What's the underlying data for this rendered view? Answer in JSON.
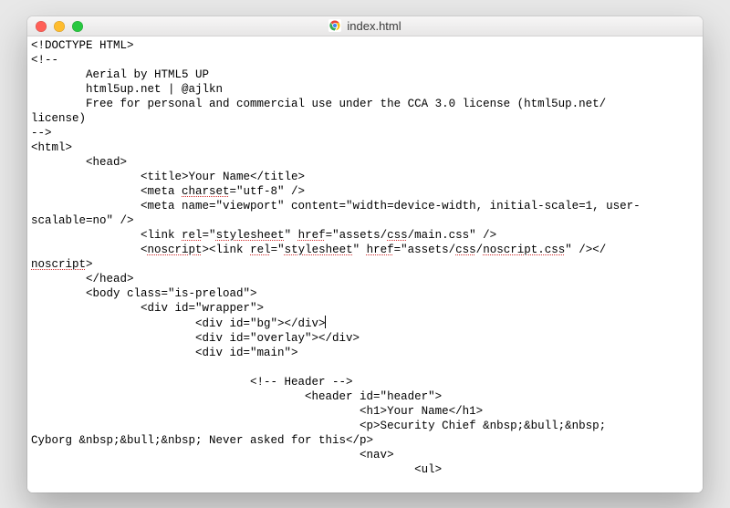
{
  "window": {
    "title": "index.html",
    "favicon_name": "chrome-icon"
  },
  "code": {
    "l01": "<!DOCTYPE HTML>",
    "l02": "<!--",
    "l03": "        Aerial by HTML5 UP",
    "l04": "        html5up.net | @ajlkn",
    "l05": "        Free for personal and commercial use under the CCA 3.0 license (html5up.net/",
    "l06": "license)",
    "l07": "-->",
    "l08": "<html>",
    "l09": "        <head>",
    "l10a": "                <title>Your Name</title>",
    "l11a": "                <meta ",
    "l11b": "charset",
    "l11c": "=\"utf-8\" />",
    "l12": "                <meta name=\"viewport\" content=\"width=device-width, initial-scale=1, user-",
    "l13": "scalable=no\" />",
    "l14a": "                <link ",
    "l14b": "rel",
    "l14c": "=\"",
    "l14d": "stylesheet",
    "l14e": "\" ",
    "l14f": "href",
    "l14g": "=\"assets/",
    "l14h": "css",
    "l14i": "/main.css\" />",
    "l15a": "                <",
    "l15b": "noscript",
    "l15c": "><link ",
    "l15d": "rel",
    "l15e": "=\"",
    "l15f": "stylesheet",
    "l15g": "\" ",
    "l15h": "href",
    "l15i": "=\"assets/",
    "l15j": "css",
    "l15k": "/",
    "l15l": "noscript.css",
    "l15m": "\" /></",
    "l16a": "noscript",
    "l16b": ">",
    "l17": "        </head>",
    "l18": "        <body class=\"is-preload\">",
    "l19": "                <div id=\"wrapper\">",
    "l20": "                        <div id=\"bg\"></div>",
    "l21": "                        <div id=\"overlay\"></div>",
    "l22": "                        <div id=\"main\">",
    "l23": "",
    "l24": "                                <!-- Header -->",
    "l25": "                                        <header id=\"header\">",
    "l26": "                                                <h1>Your Name</h1>",
    "l27": "                                                <p>Security Chief &nbsp;&bull;&nbsp; ",
    "l28": "Cyborg &nbsp;&bull;&nbsp; Never asked for this</p>",
    "l29": "                                                <nav>",
    "l30": "                                                        <ul>"
  }
}
